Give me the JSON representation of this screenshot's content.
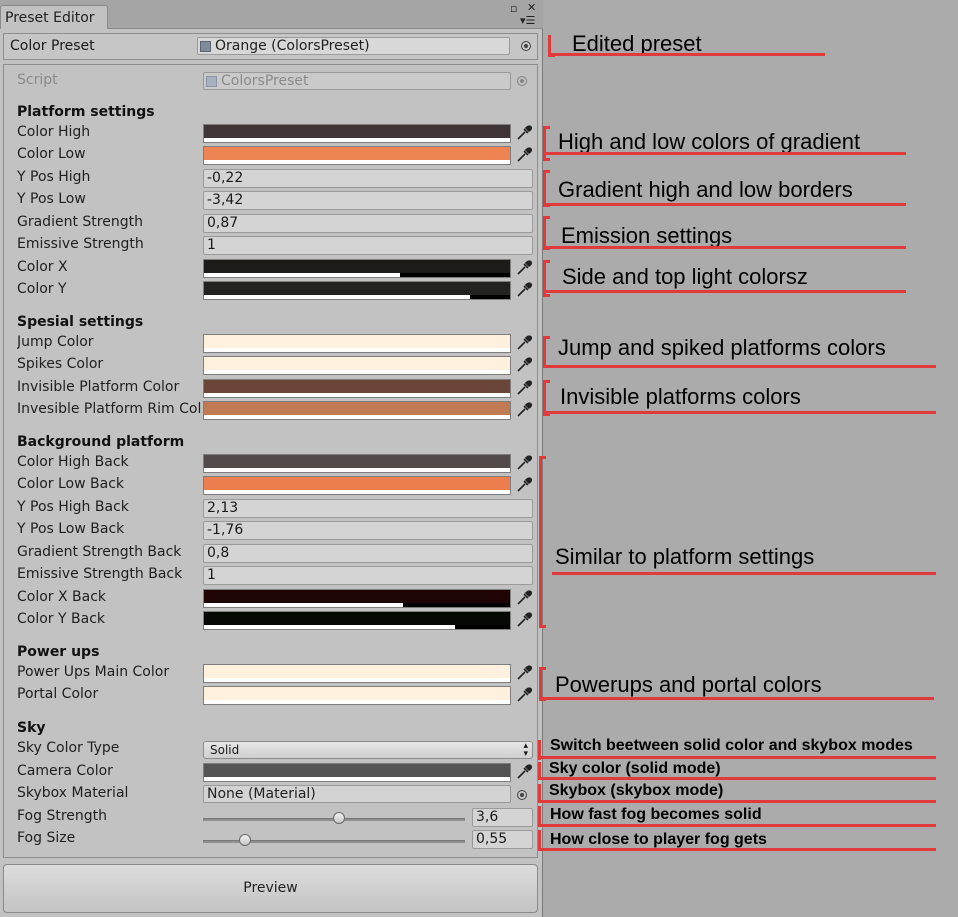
{
  "window": {
    "tab_title": "Preset Editor",
    "colors": {
      "panel_bg": "#c2c2c2",
      "outer_bg": "#ababab",
      "annotation_red": "#e23a3a"
    }
  },
  "preset": {
    "label": "Color Preset",
    "value": "Orange (ColorsPreset)"
  },
  "script": {
    "label": "Script",
    "value": "ColorsPreset"
  },
  "sections": {
    "platform": {
      "header": "Platform settings",
      "color_high": {
        "label": "Color High",
        "color": "#3f3537"
      },
      "color_low": {
        "label": "Color Low",
        "color": "#ee8454"
      },
      "y_pos_high": {
        "label": "Y Pos High",
        "value": "-0,22"
      },
      "y_pos_low": {
        "label": "Y Pos Low",
        "value": "-3,42"
      },
      "gradient_strength": {
        "label": "Gradient Strength",
        "value": "0,87"
      },
      "emissive_strength": {
        "label": "Emissive Strength",
        "value": "1"
      },
      "color_x": {
        "label": "Color X",
        "color": "#1c1b19",
        "alpha": 0.64
      },
      "color_y": {
        "label": "Color Y",
        "color": "#222220",
        "alpha": 0.87
      }
    },
    "special": {
      "header": "Spesial settings",
      "jump_color": {
        "label": "Jump Color",
        "color": "#fff1de"
      },
      "spikes_color": {
        "label": "Spikes Color",
        "color": "#fff1de"
      },
      "invisible_color": {
        "label": "Invisible Platform Color",
        "color": "#6b4638"
      },
      "invisible_rim": {
        "label": "Invesible Platform Rim Color",
        "color": "#c17b52"
      }
    },
    "background": {
      "header": "Background platform",
      "color_high_back": {
        "label": "Color High Back",
        "color": "#534a4a"
      },
      "color_low_back": {
        "label": "Color Low Back",
        "color": "#ec7d4f"
      },
      "y_pos_high_back": {
        "label": "Y Pos High Back",
        "value": "2,13"
      },
      "y_pos_low_back": {
        "label": "Y Pos Low Back",
        "value": "-1,76"
      },
      "gradient_strength_back": {
        "label": "Gradient Strength Back",
        "value": "0,8"
      },
      "emissive_strength_back": {
        "label": "Emissive Strength Back",
        "value": "1"
      },
      "color_x_back": {
        "label": "Color X Back",
        "color": "#1e0404",
        "alpha": 0.65
      },
      "color_y_back": {
        "label": "Color Y Back",
        "color": "#050805",
        "alpha": 0.82
      }
    },
    "powerups": {
      "header": "Power ups",
      "main_color": {
        "label": "Power Ups Main Color",
        "color": "#fff1de"
      },
      "portal_color": {
        "label": "Portal Color",
        "color": "#fff1de"
      }
    },
    "sky": {
      "header": "Sky",
      "sky_color_type": {
        "label": "Sky Color Type",
        "value": "Solid"
      },
      "camera_color": {
        "label": "Camera Color",
        "color": "#545454"
      },
      "skybox_material": {
        "label": "Skybox Material",
        "value": "None (Material)"
      },
      "fog_strength": {
        "label": "Fog Strength",
        "value": "3,6",
        "fraction": 0.52
      },
      "fog_size": {
        "label": "Fog Size",
        "value": "0,55",
        "fraction": 0.16
      }
    }
  },
  "preview_button": "Preview",
  "annotations": [
    "Edited preset",
    "High and low colors of gradient",
    "Gradient high and low borders",
    "Emission settings",
    "Side and top light colorsz",
    "Jump and spiked platforms colors",
    "Invisible platforms colors",
    "Similar to platform settings",
    "Powerups and portal colors",
    "Switch beetween solid color and skybox modes",
    "Sky color (solid mode)",
    "Skybox (skybox mode)",
    "How fast fog becomes solid",
    "How close to player fog gets"
  ]
}
